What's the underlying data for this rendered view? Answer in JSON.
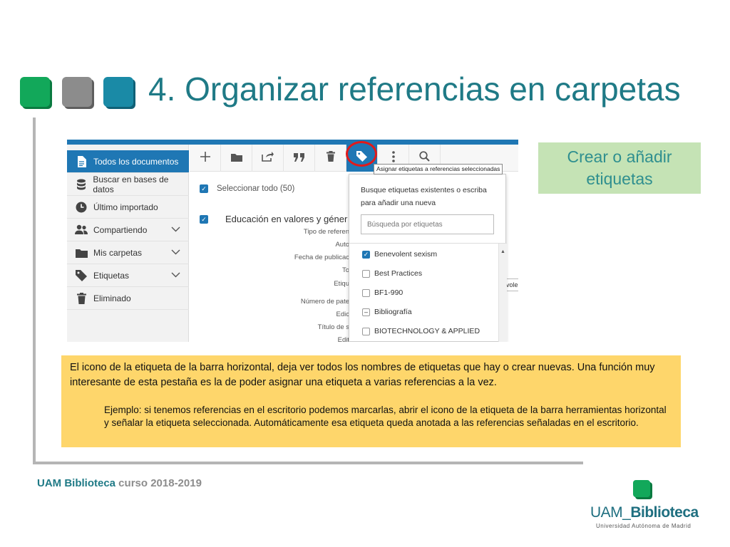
{
  "slide": {
    "title": "4. Organizar referencias en carpetas"
  },
  "sidebar": {
    "items": [
      {
        "label": "Todos los documentos",
        "icon": "document-icon",
        "active": true
      },
      {
        "label": "Buscar en bases de datos",
        "icon": "database-icon"
      },
      {
        "label": "Último importado",
        "icon": "clock-icon"
      },
      {
        "label": "Compartiendo",
        "icon": "people-icon",
        "expandable": true
      },
      {
        "label": "Mis carpetas",
        "icon": "folder-icon",
        "expandable": true
      },
      {
        "label": "Etiquetas",
        "icon": "tag-icon",
        "expandable": true
      },
      {
        "label": "Eliminado",
        "icon": "trash-icon"
      }
    ]
  },
  "toolbar": {
    "buttons": [
      "add-icon",
      "folder-icon",
      "share-icon",
      "quote-icon",
      "trash-icon",
      "tag-icon",
      "more-icon",
      "search-icon"
    ],
    "tooltip": "Asignar etiquetas a referencias seleccionadas"
  },
  "content": {
    "select_all": "Seleccionar todo (50)",
    "document_title": "Educación en valores y géner",
    "fields": [
      "Tipo de referen",
      "Auto",
      "Fecha de publicac",
      "To",
      "Etiqu",
      "Número de pate",
      "Edic",
      "Título de s",
      "Edit"
    ],
    "peek_text": "evole"
  },
  "tag_dropdown": {
    "instructions": "Busque etiquetas existentes o escriba para añadir una nueva",
    "search_placeholder": "Búsqueda por etiquetas",
    "tags": [
      {
        "label": "Benevolent sexism",
        "state": "checked"
      },
      {
        "label": "Best Practices",
        "state": "unchecked"
      },
      {
        "label": "BF1-990",
        "state": "unchecked"
      },
      {
        "label": "Bibliografía",
        "state": "partial"
      },
      {
        "label": "BIOTECHNOLOGY & APPLIED",
        "state": "unchecked"
      }
    ]
  },
  "callout": {
    "text": "Crear o añadir etiquetas"
  },
  "note": {
    "paragraph1": "El icono de la etiqueta de la barra horizontal, deja ver todos los nombres de etiquetas que hay o crear nuevas. Una función muy interesante de esta pestaña es la de poder asignar una etiqueta a varias referencias a la vez.",
    "paragraph2": "Ejemplo: si tenemos referencias en el escritorio podemos marcarlas, abrir el icono de la etiqueta de la barra herramientas horizontal y señalar la etiqueta seleccionada. Automáticamente esa etiqueta queda anotada a las referencias señaladas en el escritorio."
  },
  "footer": {
    "brand": "UAM Biblioteca",
    "course": " curso 2018-2019"
  },
  "logo": {
    "uam": "UAM_",
    "biblioteca": "Biblioteca",
    "subtitle": "Universidad Autónoma de Madrid"
  },
  "colors": {
    "title": "#1f7a86",
    "accent_blue": "#1f77b4",
    "note_bg": "#fed66b",
    "callout_bg": "#c5e3b5",
    "highlight_circle": "#e11a1a"
  }
}
